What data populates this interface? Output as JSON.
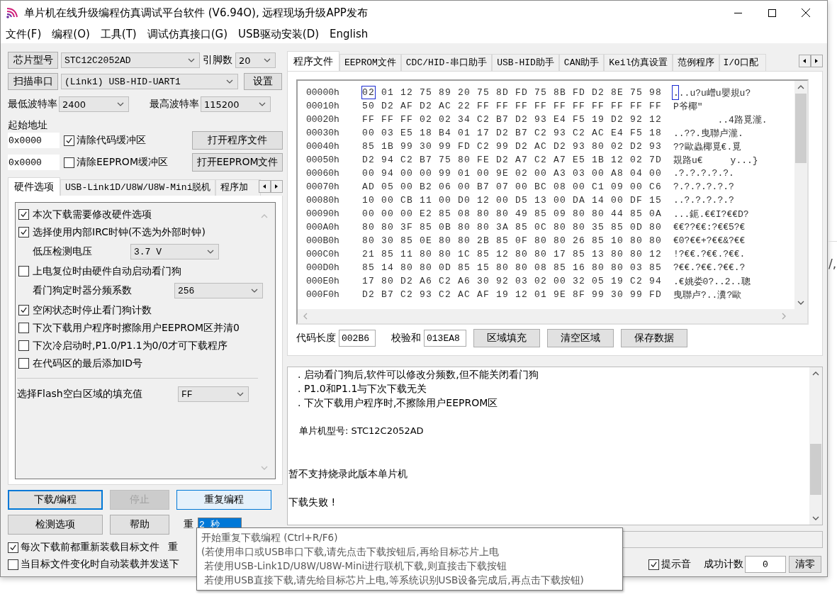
{
  "window": {
    "title": "单片机在线升级编程仿真调试平台软件 (V6.94O), 远程现场升级APP发布"
  },
  "menu": [
    "文件(F)",
    "编程(O)",
    "工具(T)",
    "调试仿真接口(G)",
    "USB驱动安装(D)",
    "English"
  ],
  "chip": {
    "button": "芯片型号",
    "model": "STC12C2052AD",
    "pins_label": "引脚数",
    "pins": "20"
  },
  "port": {
    "button": "扫描串口",
    "value": "(Link1) USB-HID-UART1",
    "settings_button": "设置"
  },
  "baud": {
    "min_label": "最低波特率",
    "min": "2400",
    "max_label": "最高波特率",
    "max": "115200"
  },
  "address": {
    "label": "起始地址",
    "code_address": "0x0000",
    "clear_code": {
      "label": "清除代码缓冲区",
      "checked": true
    },
    "open_program_button": "打开程序文件",
    "eeprom_address": "0x0000",
    "clear_eeprom": {
      "label": "清除EEPROM缓冲区",
      "checked": false
    },
    "open_eeprom_button": "打开EEPROM文件"
  },
  "option_tabs": [
    {
      "label": "硬件选项",
      "selected": true
    },
    {
      "label": "USB-Link1D/U8W/U8W-Mini脱机",
      "selected": false
    },
    {
      "label": "程序加",
      "selected": false
    }
  ],
  "hardware_options": [
    {
      "kind": "checkbox",
      "label": "本次下载需要修改硬件选项",
      "checked": true
    },
    {
      "kind": "checkbox",
      "label": "选择使用内部IRC时钟(不选为外部时钟)",
      "checked": true
    },
    {
      "kind": "select",
      "label": "低压检测电压",
      "value": "3.7 V"
    },
    {
      "kind": "checkbox",
      "label": "上电复位时由硬件自动启动看门狗",
      "checked": false
    },
    {
      "kind": "select",
      "label": "看门狗定时器分频系数",
      "value": "256"
    },
    {
      "kind": "checkbox",
      "label": "空闲状态时停止看门狗计数",
      "checked": true
    },
    {
      "kind": "checkbox",
      "label": "下次下载用户程序时擦除用户EEPROM区并清0",
      "checked": false
    },
    {
      "kind": "checkbox",
      "label": "下次冷启动时,P1.0/P1.1为0/0才可下载程序",
      "checked": false
    },
    {
      "kind": "checkbox",
      "label": "在代码区的最后添加ID号",
      "checked": false
    },
    {
      "kind": "fill",
      "label": "选择Flash空白区域的填充值",
      "value": "FF"
    }
  ],
  "actions": {
    "download": {
      "label": "下载/编程",
      "focused": true
    },
    "stop": {
      "label": "停止",
      "disabled": true
    },
    "repeat": {
      "label": "重复编程",
      "hovered": true
    },
    "check": "检测选项",
    "help": "帮助",
    "repeat_delay_label": "重",
    "repeat_delay": "2 秒",
    "repeat_count_label": "重"
  },
  "reload_options": [
    {
      "label": "每次下载前都重新装载目标文件",
      "checked": true
    },
    {
      "label": "当目标文件变化时自动装载并发送下",
      "checked": false
    }
  ],
  "file_tabs": [
    {
      "label": "程序文件",
      "selected": true
    },
    {
      "label": "EEPROM文件",
      "selected": false
    },
    {
      "label": "CDC/HID-串口助手",
      "selected": false
    },
    {
      "label": "USB-HID助手",
      "selected": false
    },
    {
      "label": "CAN助手",
      "selected": false
    },
    {
      "label": "Keil仿真设置",
      "selected": false
    },
    {
      "label": "范例程序",
      "selected": false
    },
    {
      "label": "I/O口配",
      "selected": false
    }
  ],
  "hex_view": {
    "rows": [
      {
        "address": "00000h",
        "bytes": "02 01 12 75 89 20 75 8D FD 75 8B FD D2 8E 75 98",
        "ascii": "...u?u嶒u嬰規u?",
        "cursor": true
      },
      {
        "address": "00010h",
        "bytes": "50 D2 AF D2 AC 22 FF FF FF FF FF FF FF FF FF FF",
        "ascii": "P爷椰\"",
        "cursor": false
      },
      {
        "address": "00020h",
        "bytes": "FF FF FF 02 02 34 C2 B7 D2 93 E4 F5 19 D2 92 12",
        "ascii": "        ..4路覓瀧.",
        "cursor": false
      },
      {
        "address": "00030h",
        "bytes": "00 03 E5 18 B4 01 17 D2 B7 C2 93 C2 AC E4 F5 18",
        "ascii": "..??.曳聯卢瀧.",
        "cursor": false
      },
      {
        "address": "00040h",
        "bytes": "85 1B 99 30 99 FD C2 99 D2 AC D2 93 80 02 D2 93",
        "ascii": "??歐蟲椰覓€.覓",
        "cursor": false
      },
      {
        "address": "00050h",
        "bytes": "D2 94 C2 B7 75 80 FE D2 A7 C2 A7 E5 1B 12 02 7D",
        "ascii": "覝路u€     y...}",
        "cursor": false
      },
      {
        "address": "00060h",
        "bytes": "00 94 00 00 99 01 00 9E 02 00 A3 03 00 A8 04 00",
        "ascii": ".?.?.?.?.?.",
        "cursor": false
      },
      {
        "address": "00070h",
        "bytes": "AD 05 00 B2 06 00 B7 07 00 BC 08 00 C1 09 00 C6",
        "ascii": "?.?.?.?.?.?",
        "cursor": false
      },
      {
        "address": "00080h",
        "bytes": "10 00 CB 11 00 D0 12 00 D5 13 00 DA 14 00 DF 15",
        "ascii": "..?.?.?.?.?",
        "cursor": false
      },
      {
        "address": "00090h",
        "bytes": "00 00 00 E2 85 08 80 80 49 85 09 80 80 44 85 0A",
        "ascii": "...鈪.€€I?€€D?",
        "cursor": false
      },
      {
        "address": "000A0h",
        "bytes": "80 80 3F 85 0B 80 80 3A 85 0C 80 80 35 85 0D 80",
        "ascii": "€€??€€:?€€5?€",
        "cursor": false
      },
      {
        "address": "000B0h",
        "bytes": "80 30 85 0E 80 80 2B 85 0F 80 80 26 85 10 80 80",
        "ascii": "€0?€€+?€€&?€€",
        "cursor": false
      },
      {
        "address": "000C0h",
        "bytes": "21 85 11 80 80 1C 85 12 80 80 17 85 13 80 80 12",
        "ascii": "!?€€.?€€.?€€.",
        "cursor": false
      },
      {
        "address": "000D0h",
        "bytes": "85 14 80 80 0D 85 15 80 80 08 85 16 80 80 03 85",
        "ascii": "?€€.?€€.?€€.?",
        "cursor": false
      },
      {
        "address": "000E0h",
        "bytes": "17 80 D2 A6 C2 A6 30 92 03 02 00 32 05 19 C2 94",
        "ascii": ".€姚娄0?..2..聰",
        "cursor": false
      },
      {
        "address": "000F0h",
        "bytes": "D2 B7 C2 93 C2 AC AF 19 12 01 9E 8F 99 30 99 FD",
        "ascii": "曳聯卢?..瀵?歐",
        "cursor": false
      }
    ]
  },
  "code_info": {
    "length_label": "代码长度",
    "length": "002B6",
    "checksum_label": "校验和",
    "checksum": "013EA8",
    "buttons": [
      "区域填充",
      "清空区域",
      "保存数据"
    ]
  },
  "log": [
    {
      "kind": "bullet",
      "text": ". 启动看门狗后,软件可以修改分频数,但不能关闭看门狗"
    },
    {
      "kind": "bullet",
      "text": ". P1.0和P1.1与下次下载无关"
    },
    {
      "kind": "bullet",
      "text": ". 下次下载用户程序时,不擦除用户EEPROM区"
    },
    {
      "kind": "info",
      "text": "单片机型号: STC12C2052AD"
    },
    {
      "kind": "message",
      "text": "暂不支持烧录此版本单片机"
    },
    {
      "kind": "message",
      "text": "下载失败 !"
    }
  ],
  "footer": {
    "sound": {
      "label": "提示音",
      "checked": true
    },
    "count_label": "成功计数",
    "count": "0",
    "reset_button": "清零"
  },
  "tooltip": {
    "lines": [
      "开始重复下载编程 (Ctrl+R/F6)",
      "(若使用串口或USB串口下载,请先点击下载按钮后,再给目标芯片上电",
      " 若使用USB-Link1D/U8W/U8W-Mini进行联机下载,则直接击下载按钮",
      " 若使用USB直接下载,请先给目标芯片上电,等系统识别USB设备完成后,再点击下载按钮)"
    ]
  },
  "background_text": "/,"
}
